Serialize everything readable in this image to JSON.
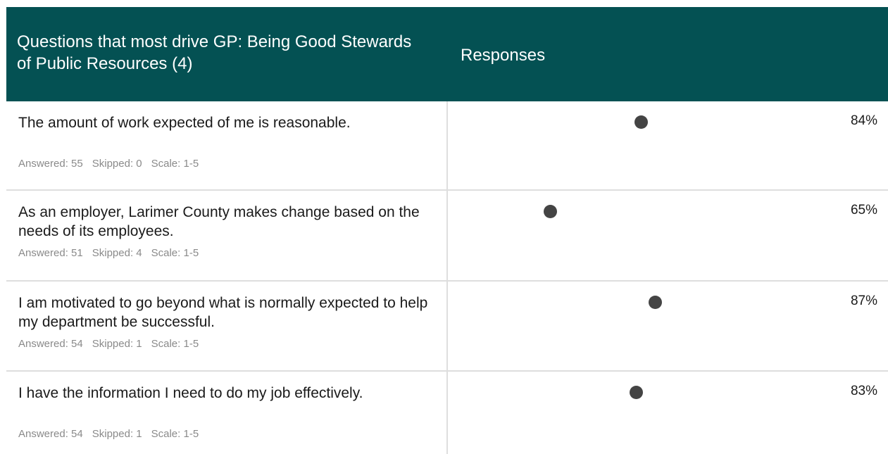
{
  "header": {
    "question_title": "Questions that most drive GP: Being Good Stewards of Public Resources (4)",
    "responses_title": "Responses"
  },
  "rows": [
    {
      "question": "The amount of work expected of me is reasonable.",
      "answered": "Answered: 55",
      "skipped": "Skipped: 0",
      "scale": "Scale: 1-5",
      "percent_label": "84%",
      "percent": 84
    },
    {
      "question": "As an employer, Larimer County makes change based on the needs of its employees.",
      "answered": "Answered: 51",
      "skipped": "Skipped: 4",
      "scale": "Scale: 1-5",
      "percent_label": "65%",
      "percent": 65
    },
    {
      "question": "I am motivated to go beyond what is normally expected to help my department be successful.",
      "answered": "Answered: 54",
      "skipped": "Skipped: 1",
      "scale": "Scale: 1-5",
      "percent_label": "87%",
      "percent": 87
    },
    {
      "question": "I have the information I need to do my job effectively.",
      "answered": "Answered: 54",
      "skipped": "Skipped: 1",
      "scale": "Scale: 1-5",
      "percent_label": "83%",
      "percent": 83
    }
  ],
  "colors": {
    "header_bg": "#045153",
    "dot": "#444444",
    "divider": "#dedede"
  }
}
